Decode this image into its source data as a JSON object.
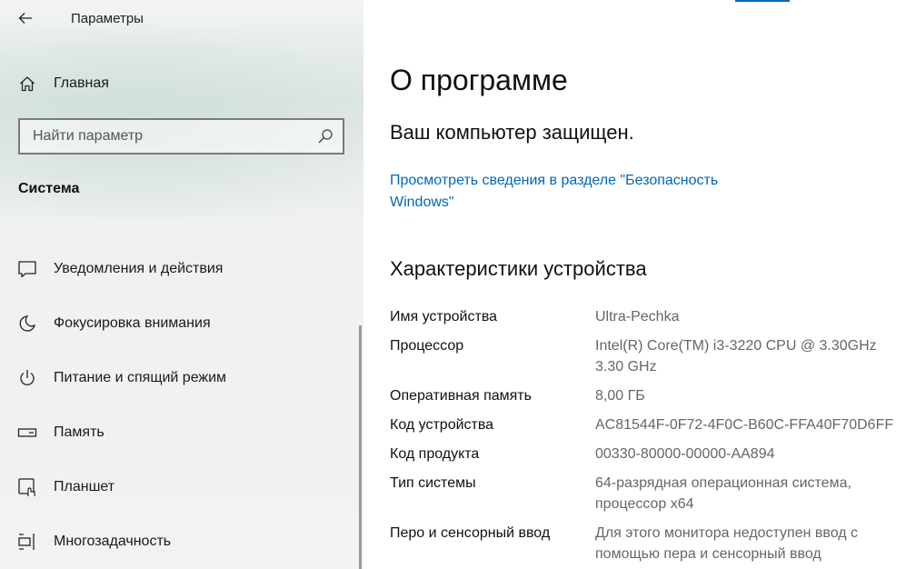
{
  "window": {
    "title": "Параметры"
  },
  "sidebar": {
    "home_label": "Главная",
    "search": {
      "placeholder": "Найти параметр",
      "value": ""
    },
    "section_title": "Система",
    "items": [
      {
        "label": "Уведомления и действия",
        "icon": "notification-icon"
      },
      {
        "label": "Фокусировка внимания",
        "icon": "moon-icon"
      },
      {
        "label": "Питание и спящий режим",
        "icon": "power-icon"
      },
      {
        "label": "Память",
        "icon": "storage-icon"
      },
      {
        "label": "Планшет",
        "icon": "tablet-icon"
      },
      {
        "label": "Многозадачность",
        "icon": "multitasking-icon"
      }
    ]
  },
  "main": {
    "page_title": "О программе",
    "protection_status": "Ваш компьютер защищен.",
    "security_link": "Просмотреть сведения в разделе \"Безопасность Windows\"",
    "specs_title": "Характеристики устройства",
    "specs": [
      {
        "label": "Имя устройства",
        "value": "Ultra-Pechka"
      },
      {
        "label": "Процессор",
        "value": "Intel(R) Core(TM) i3-3220 CPU @ 3.30GHz 3.30 GHz"
      },
      {
        "label": "Оперативная память",
        "value": "8,00 ГБ"
      },
      {
        "label": "Код устройства",
        "value": "AC81544F-0F72-4F0C-B60C-FFA40F70D6FF"
      },
      {
        "label": "Код продукта",
        "value": "00330-80000-00000-AA894"
      },
      {
        "label": "Тип системы",
        "value": "64-разрядная операционная система, процессор x64"
      },
      {
        "label": "Перо и сенсорный ввод",
        "value": "Для этого монитора недоступен ввод с помощью пера и сенсорный ввод"
      }
    ]
  },
  "colors": {
    "accent": "#0067b8",
    "secondary_text": "#666666"
  }
}
